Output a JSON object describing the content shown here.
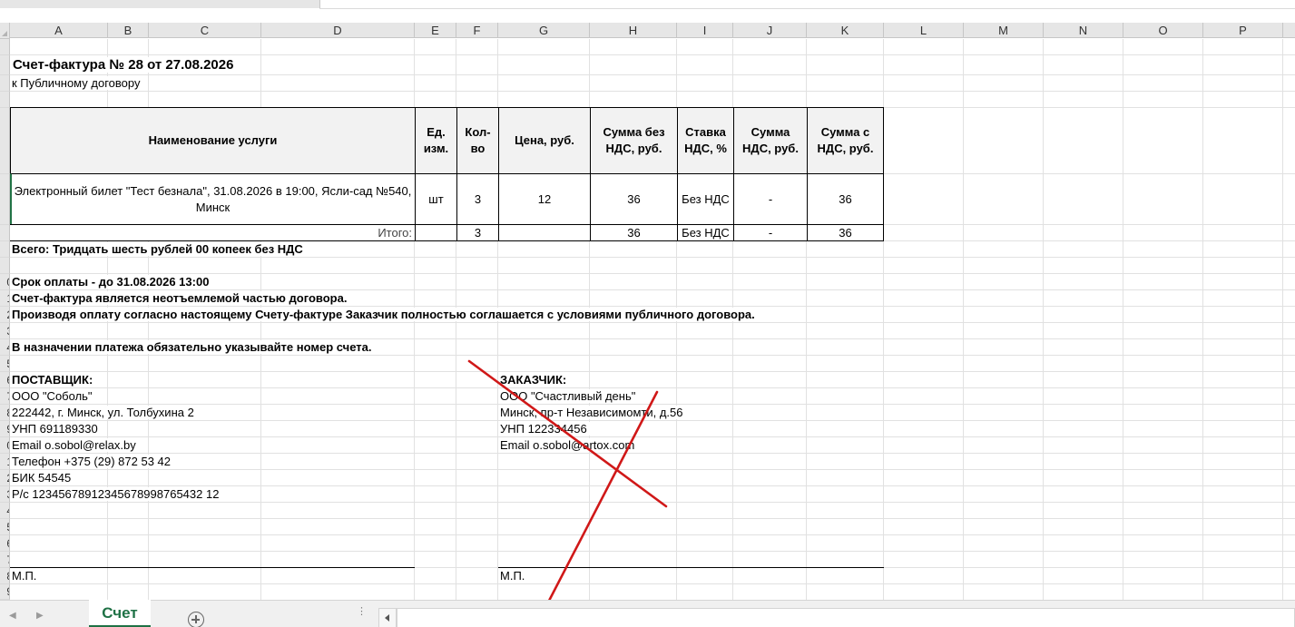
{
  "columns": [
    "A",
    "B",
    "C",
    "D",
    "E",
    "F",
    "G",
    "H",
    "I",
    "J",
    "K",
    "L",
    "M",
    "N",
    "O",
    "P"
  ],
  "row_numbers": [
    "",
    "",
    "",
    "",
    "",
    "",
    "",
    "",
    "",
    "0",
    "1",
    "2",
    "3",
    "4",
    "5",
    "6",
    "7",
    "8",
    "9",
    "0",
    "1",
    "2",
    "3",
    "4",
    "5",
    "6",
    "7",
    "8",
    "9"
  ],
  "invoice": {
    "title": "Счет-фактура № 28 от 27.08.2026",
    "subtitle": "к Публичному договору",
    "table_headers": {
      "name": "Наименование услуги",
      "unit": "Ед. изм.",
      "qty": "Кол-во",
      "price": "Цена, руб.",
      "sum_no_vat": "Сумма без НДС, руб.",
      "vat_rate": "Ставка НДС, %",
      "vat_sum": "Сумма НДС, руб.",
      "sum_with_vat": "Сумма с НДС, руб."
    },
    "item": {
      "name": "Электронный билет \"Тест безнала\", 31.08.2026 в 19:00, Ясли-сад №540, Минск",
      "unit": "шт",
      "qty": "3",
      "price": "12",
      "sum_no_vat": "36",
      "vat_rate": "Без НДС",
      "vat_sum": "-",
      "sum_with_vat": "36"
    },
    "total": {
      "label": "Итого:",
      "qty": "3",
      "sum_no_vat": "36",
      "vat_rate": "Без НДС",
      "vat_sum": "-",
      "sum_with_vat": "36"
    },
    "total_words": "Всего: Тридцать шесть рублей 00 копеек без НДС",
    "payment_deadline": "Срок оплаты - до 31.08.2026 13:00",
    "note1": "Счет-фактура является неотъемлемой частью договора.",
    "note2": "Производя оплату согласно настоящему Счету-фактуре Заказчик полностью соглашается с условиями публичного договора.",
    "note3": "В назначении платежа обязательно указывайте номер счета.",
    "supplier": {
      "heading": "ПОСТАВЩИК:",
      "name": "ООО \"Соболь\"",
      "address": "222442, г. Минск, ул. Толбухина 2",
      "unp": "УНП 691189330",
      "email": "Email o.sobol@relax.by",
      "phone": "Телефон +375 (29) 872 53 42",
      "bik": "БИК 54545",
      "account": "Р/с 12345678912345678998765432 12",
      "stamp": "М.П."
    },
    "customer": {
      "heading": "ЗАКАЗЧИК:",
      "name": "ООО \"Счастливый день\"",
      "address": "Минск, пр-т Независимомти, д.56",
      "unp": "УНП 122334456",
      "email": "Email o.sobol@artox.com",
      "stamp": "М.П."
    }
  },
  "sheet_tabs": [
    {
      "label": "Счет",
      "active": true
    }
  ],
  "accent_color": "#1e7145",
  "annotation_color": "#d01818"
}
